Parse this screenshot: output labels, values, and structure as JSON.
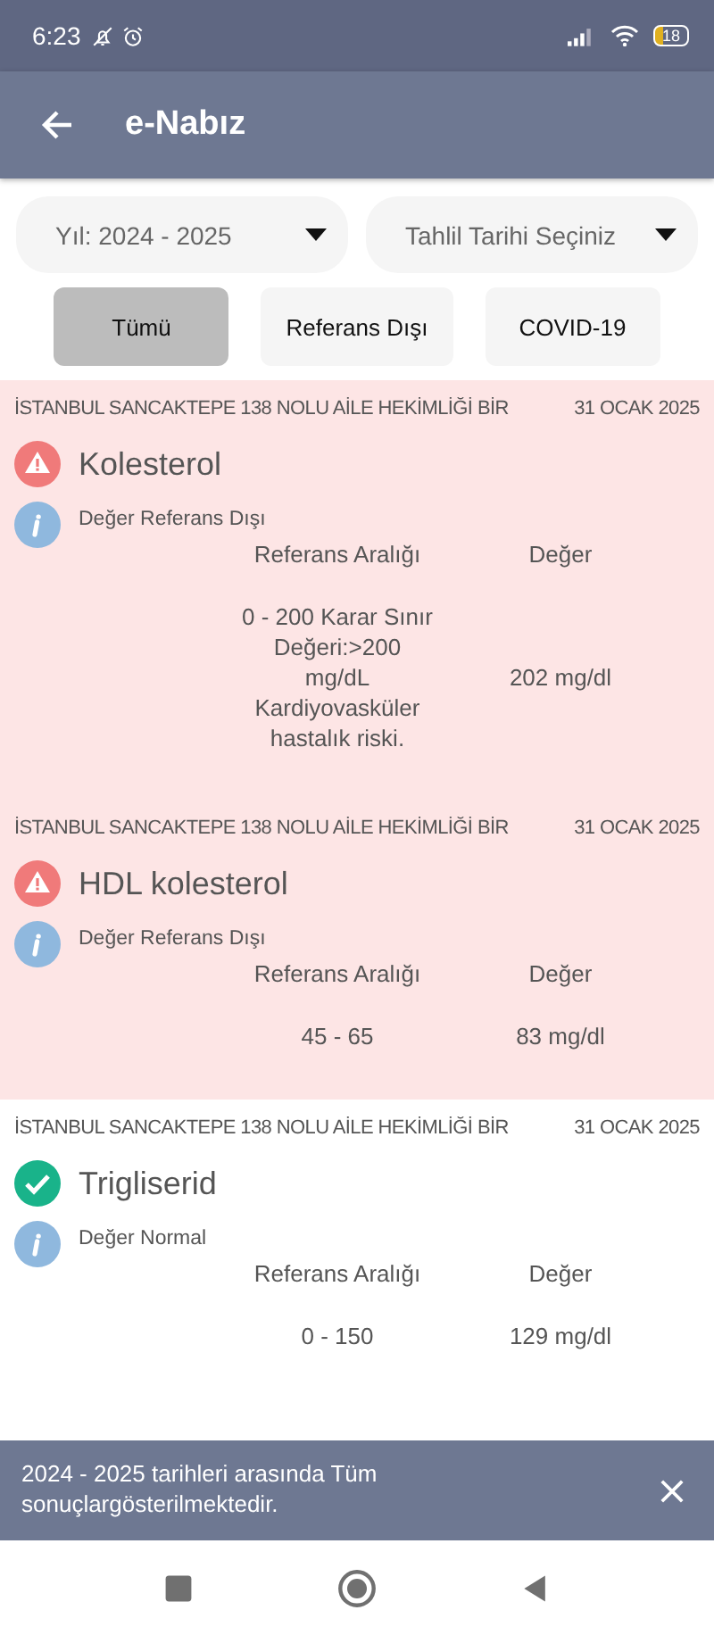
{
  "status_bar": {
    "time": "6:23",
    "battery": "18"
  },
  "app_bar": {
    "title": "e-Nabız"
  },
  "dropdowns": [
    {
      "value": "Yıl: 2024 - 2025"
    },
    {
      "value": "Tahlil Tarihi Seçiniz"
    }
  ],
  "filters": [
    {
      "label": "Tümü",
      "selected": true
    },
    {
      "label": "Referans Dışı",
      "selected": false
    },
    {
      "label": "COVID-19",
      "selected": false
    }
  ],
  "results": [
    {
      "institution": "İSTANBUL SANCAKTEPE 138 NOLU AİLE HEKİMLİĞİ BİR",
      "date": "31 OCAK 2025",
      "test": "Kolesterol",
      "kind": "abnormal",
      "status_text": "Değer Referans Dışı",
      "range_label": "Referans Aralığı",
      "value_label": "Değer",
      "range": "0 - 200 Karar Sınır Değeri:>200 mg/dL Kardiyovasküler hastalık riski.",
      "value": "202 mg/dl"
    },
    {
      "institution": "İSTANBUL SANCAKTEPE 138 NOLU AİLE HEKİMLİĞİ BİR",
      "date": "31 OCAK 2025",
      "test": "HDL kolesterol",
      "kind": "abnormal",
      "status_text": "Değer Referans Dışı",
      "range_label": "Referans Aralığı",
      "value_label": "Değer",
      "range": "45 - 65",
      "value": "83 mg/dl"
    },
    {
      "institution": "İSTANBUL SANCAKTEPE 138 NOLU AİLE HEKİMLİĞİ BİR",
      "date": "31 OCAK 2025",
      "test": "Trigliserid",
      "kind": "normal",
      "status_text": "Değer Normal",
      "range_label": "Referans Aralığı",
      "value_label": "Değer",
      "range": "0 - 150",
      "value": "129 mg/dl"
    }
  ],
  "banner": {
    "text": "2024 - 2025 tarihleri arasında Tüm sonuçlargösterilmektedir."
  }
}
